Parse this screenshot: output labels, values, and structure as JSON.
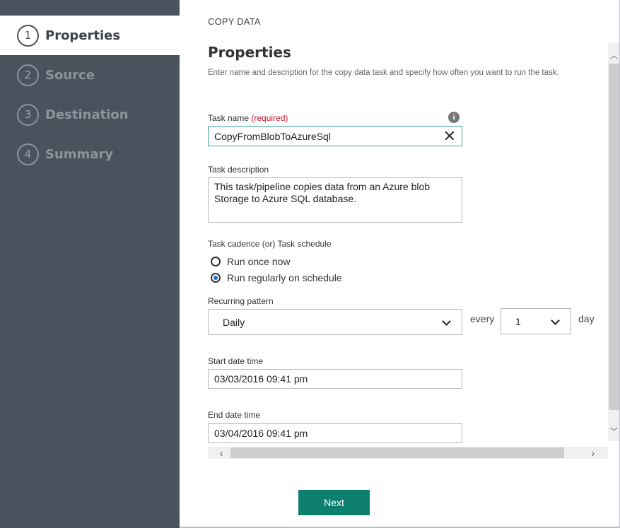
{
  "sidebar": {
    "steps": [
      {
        "num": "1",
        "label": "Properties"
      },
      {
        "num": "2",
        "label": "Source"
      },
      {
        "num": "3",
        "label": "Destination"
      },
      {
        "num": "4",
        "label": "Summary"
      }
    ]
  },
  "header": {
    "label": "COPY DATA"
  },
  "section": {
    "title": "Properties",
    "description": "Enter name and description for the copy data task and specify how often you want to run the task."
  },
  "task_name": {
    "label": "Task name",
    "required": "(required)",
    "value": "CopyFromBlobToAzureSql"
  },
  "task_description": {
    "label": "Task description",
    "value": "This task/pipeline copies data from an Azure blob Storage to Azure SQL database."
  },
  "cadence": {
    "label": "Task cadence (or) Task schedule",
    "options": [
      "Run once now",
      "Run regularly on schedule"
    ],
    "selected": "Run regularly on schedule"
  },
  "recurring": {
    "label": "Recurring pattern",
    "pattern": "Daily",
    "every_label": "every",
    "interval": "1",
    "unit": "day"
  },
  "start_date": {
    "label": "Start date time",
    "value": "03/03/2016 09:41 pm"
  },
  "end_date": {
    "label": "End date time",
    "value": "03/04/2016 09:41 pm"
  },
  "actions": {
    "next_label": "Next"
  },
  "colors": {
    "sidebar_bg": "#4a535d",
    "accent": "#0d7f6e",
    "required": "#c8102e",
    "focus": "#3aa79a",
    "radio_selected": "#1a73c9"
  }
}
